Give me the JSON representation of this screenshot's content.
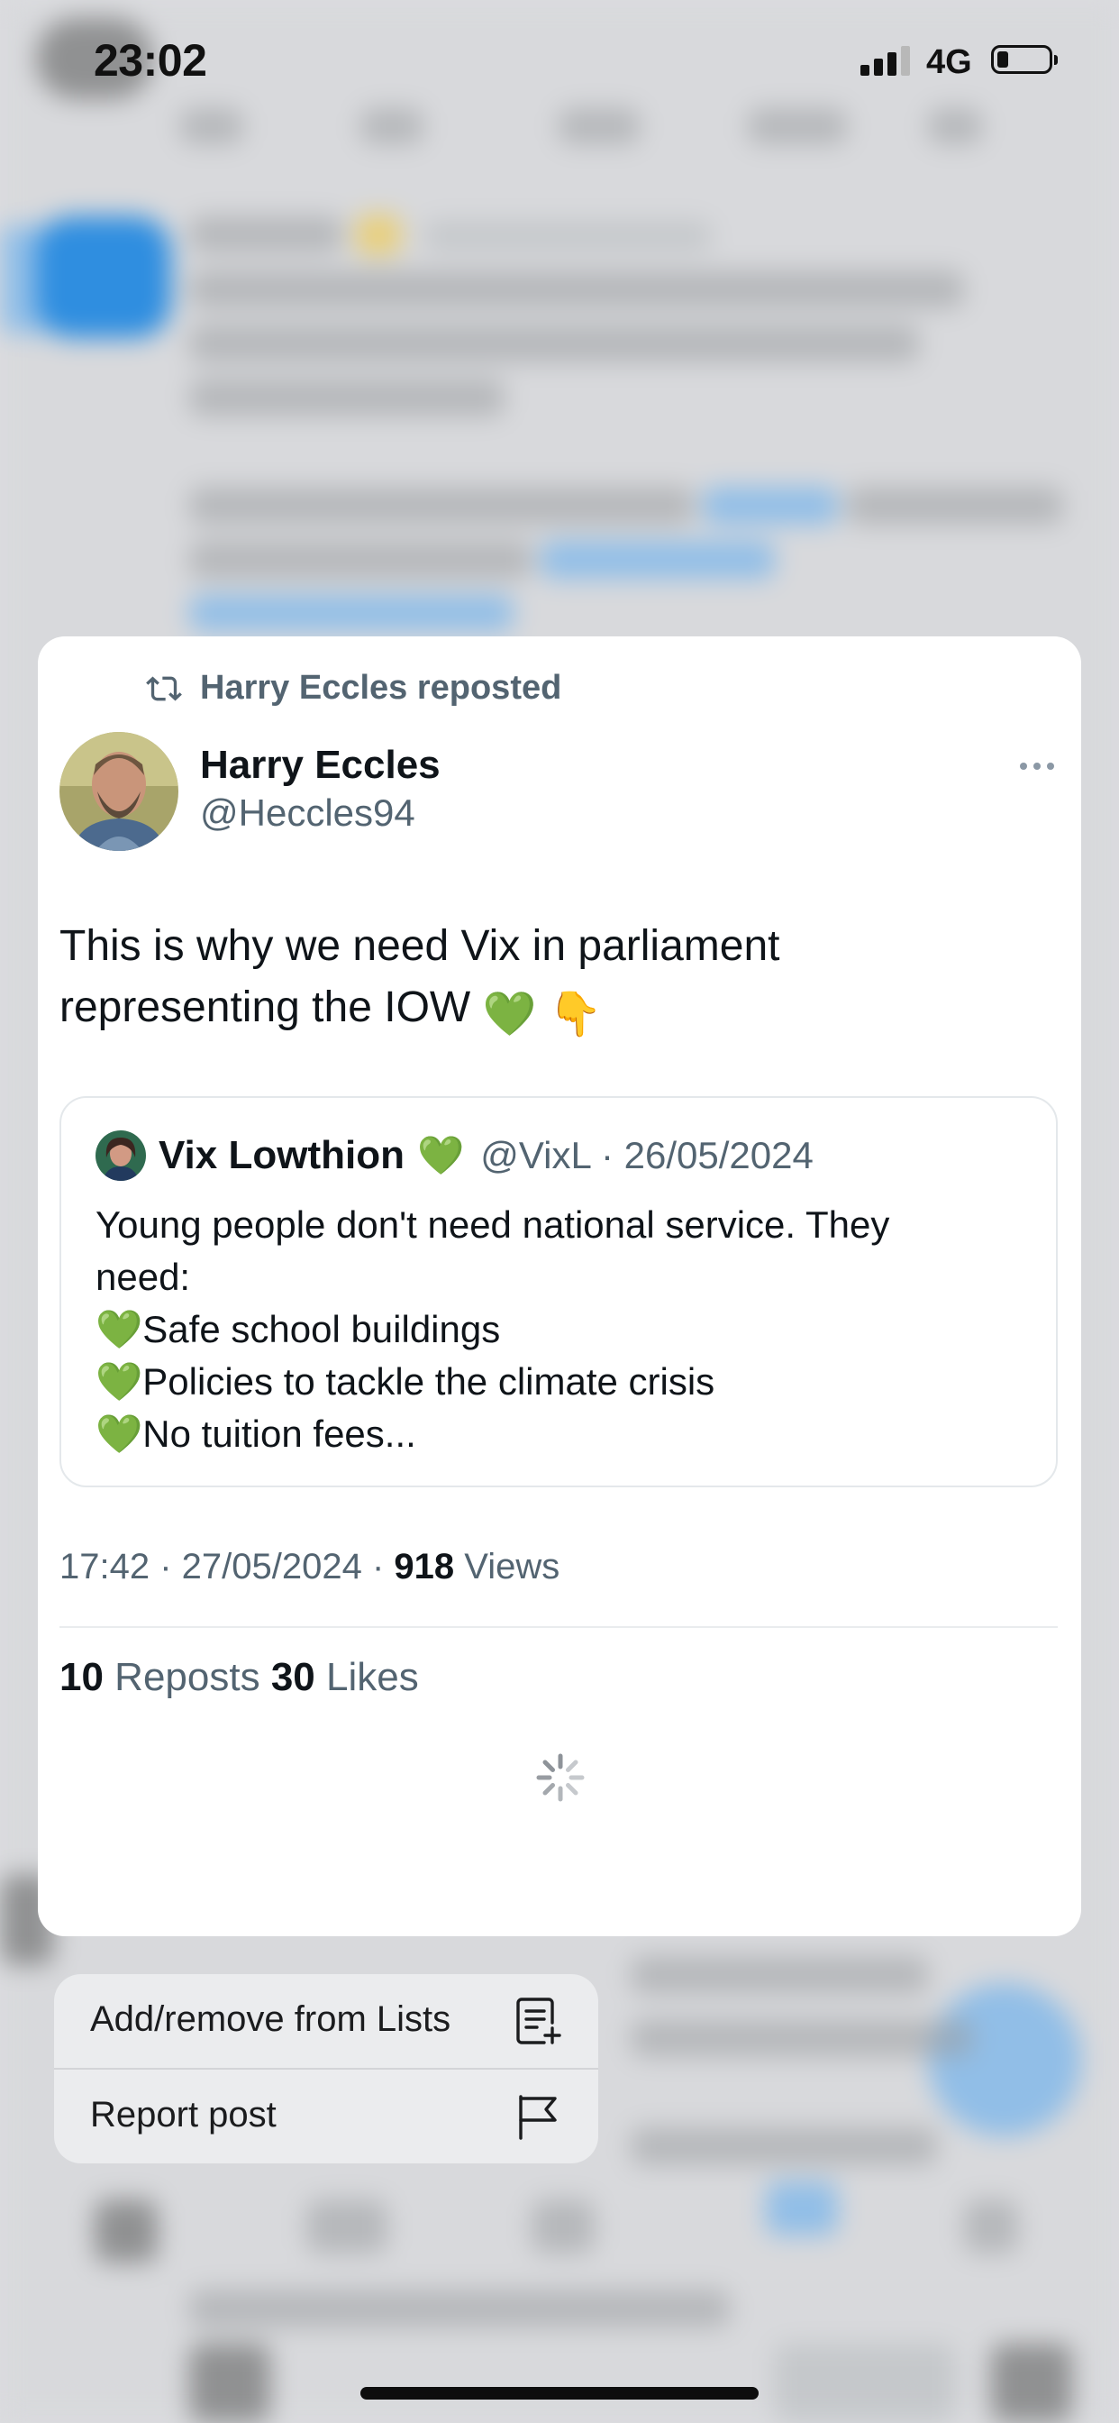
{
  "status_bar": {
    "time": "23:02",
    "network": "4G",
    "signal_bars_filled": 3,
    "battery_level": "low"
  },
  "tweet": {
    "repost_label": "Harry Eccles reposted",
    "author_name": "Harry Eccles",
    "author_handle": "@Heccles94",
    "text_line1": "This is why we need Vix in parliament",
    "text_line2": "representing the IOW",
    "text_emoji1": "💚",
    "text_emoji2": "👇",
    "quoted": {
      "name": "Vix Lowthion",
      "name_emoji": "💚",
      "meta": "@VixL · 26/05/2024",
      "line1": "Young people don't need national service. They",
      "line2": "need:",
      "items": [
        "Safe school buildings",
        "Policies to tackle the climate crisis",
        "No tuition fees..."
      ]
    },
    "timestamp": "17:42 · 27/05/2024 · ",
    "views_count": "918",
    "views_label": " Views",
    "reposts_count": "10",
    "reposts_label": " Reposts",
    "likes_count": "30",
    "likes_label": " Likes"
  },
  "menu": {
    "items": [
      {
        "label": "Add/remove from Lists",
        "icon": "list-add-icon"
      },
      {
        "label": "Report post",
        "icon": "flag-icon"
      }
    ]
  },
  "colors": {
    "primary_text": "#0f1419",
    "secondary_text": "#536471",
    "card_background": "#ffffff",
    "menu_background": "#ecedef"
  }
}
